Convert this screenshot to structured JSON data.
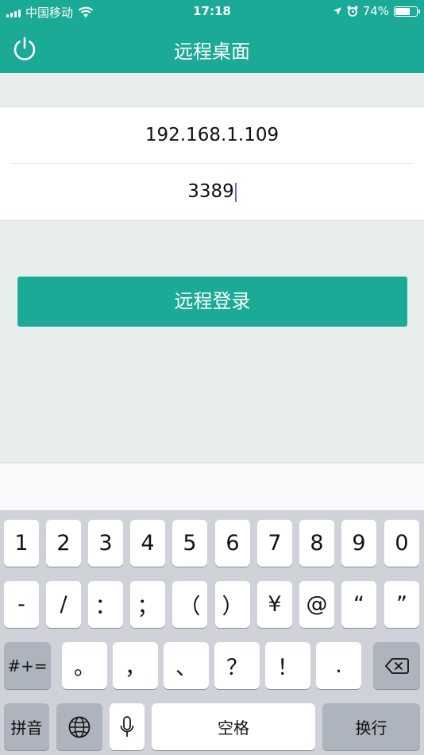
{
  "status_bar": {
    "carrier": "中国移动",
    "time": "17:18",
    "battery_percent": "74%",
    "battery_level": 0.74
  },
  "header": {
    "title": "远程桌面",
    "power_icon": "power-icon"
  },
  "form": {
    "host": "192.168.1.109",
    "port": "3389"
  },
  "login_button": "远程登录",
  "colors": {
    "accent": "#1aaa96",
    "background": "#e8eeec"
  },
  "keyboard": {
    "row1": [
      "1",
      "2",
      "3",
      "4",
      "5",
      "6",
      "7",
      "8",
      "9",
      "0"
    ],
    "row2": [
      "-",
      "/",
      "：",
      "；",
      "（",
      "）",
      "¥",
      "@",
      "“",
      "”"
    ],
    "row3_mode": "#+=",
    "row3": [
      "。",
      "，",
      "、",
      "？",
      "！",
      "."
    ],
    "pinyin": "拼音",
    "space": "空格",
    "return": "换行"
  }
}
